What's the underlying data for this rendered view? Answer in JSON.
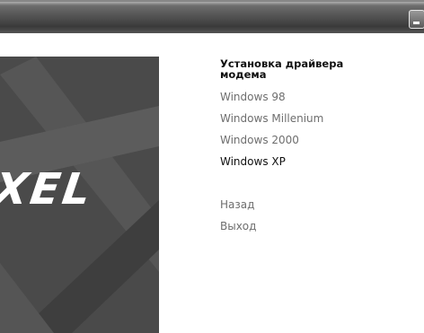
{
  "window": {
    "controls": {
      "minimize_icon": "minimize-icon"
    }
  },
  "brand": {
    "logo_text": "XEL"
  },
  "menu": {
    "heading": "Установка драйвера модема",
    "os_items": [
      {
        "label": "Windows 98",
        "active": false
      },
      {
        "label": "Windows Millenium",
        "active": false
      },
      {
        "label": "Windows 2000",
        "active": false
      },
      {
        "label": "Windows XP",
        "active": true
      }
    ],
    "nav_items": [
      {
        "label": "Назад"
      },
      {
        "label": "Выход"
      }
    ]
  },
  "colors": {
    "titlebar": "#4e4e4e",
    "panel": "#4a4a4a",
    "item_inactive": "#6e6e6e",
    "item_active": "#111111"
  }
}
